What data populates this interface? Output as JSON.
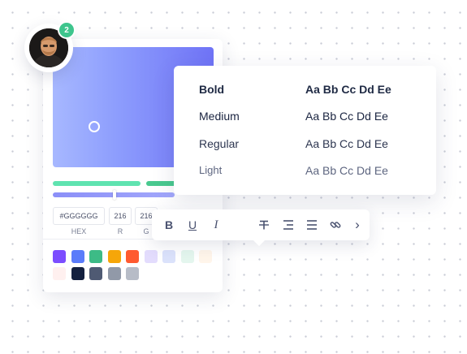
{
  "avatar": {
    "badge_count": "2"
  },
  "color_picker": {
    "inputs": [
      {
        "value": "#GGGGGG",
        "label": "HEX"
      },
      {
        "value": "216",
        "label": "R"
      },
      {
        "value": "216",
        "label": "G"
      }
    ],
    "swatches_row1": [
      "#7c4dff",
      "#5b7cfa",
      "#3dbb86",
      "#f6a609",
      "#ff5a30",
      "#e3dcfd",
      "#dbe2fb",
      "#e4f6ee",
      "#fff5ea"
    ],
    "swatches_row2": [
      "#fff0ef",
      "#13203f",
      "#4f5a73",
      "#9199a8",
      "#b7bcc7"
    ]
  },
  "typography": {
    "rows": [
      {
        "weight": "Bold",
        "sample": "Aa Bb Cc Dd Ee"
      },
      {
        "weight": "Medium",
        "sample": "Aa Bb Cc Dd Ee"
      },
      {
        "weight": "Regular",
        "sample": "Aa Bb Cc Dd Ee"
      },
      {
        "weight": "Light",
        "sample": "Aa Bb Cc Dd Ee"
      }
    ]
  },
  "toolbar": {
    "bold_label": "B",
    "underline_label": "U",
    "italic_label": "I",
    "more_label": "›"
  }
}
